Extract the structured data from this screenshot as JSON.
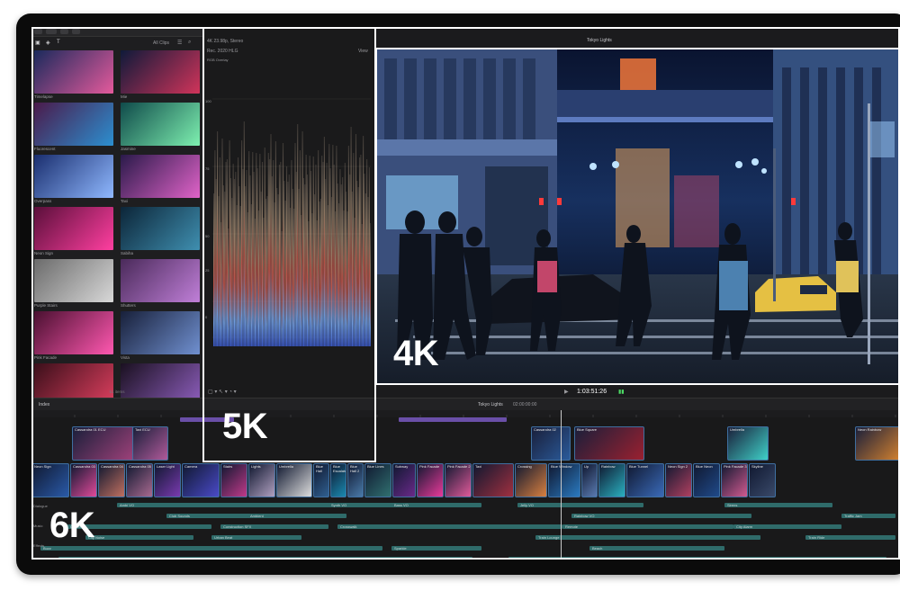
{
  "browser": {
    "filter": "All Clips",
    "count": "51 items",
    "clips": [
      "Timelapse",
      "Mie",
      "Fluorescent",
      "Jasmine",
      "Overpass",
      "Taxi",
      "Neon Sign",
      "Sabiha",
      "Purple Stairs",
      "Shutters",
      "Pink Facade",
      "Vista",
      "",
      ""
    ]
  },
  "scope": {
    "format": "4K 23.98p, Stereo",
    "colorspace": "Rec. 2020 HLG",
    "mode": "RGB Overlay",
    "scale": [
      "100",
      "75",
      "50",
      "25",
      "0"
    ]
  },
  "viewer": {
    "title": "Tokyo Lights",
    "view": "View",
    "zoom": "View ▾"
  },
  "labels": {
    "k4": "4K",
    "k5": "5K",
    "k6": "6K"
  },
  "timeline": {
    "index": "Index",
    "project": "Tokyo Lights",
    "timecode": "1:03:51:26",
    "duration": "02:00:00:00",
    "titles": [
      "Night 1",
      "Night 2"
    ],
    "connected": [
      "Cassandra 01 ECU",
      "Cassandra 02",
      "Blue Square",
      "Umbrella",
      "Neon Rainbow",
      "Taxi ECU"
    ],
    "main": [
      "Neon Sign",
      "Cassandra 03",
      "Cassandra 04",
      "Cassandra 05",
      "Laser Light",
      "Camera",
      "Stairs",
      "Lights",
      "Umbrella",
      "Blue Hall",
      "Blue Escalator",
      "Blue Hall 2",
      "Blue Lines",
      "Subway",
      "Pink Facade",
      "Pink Facade 2",
      "Taxi",
      "Crossing",
      "Blue Window",
      "Up",
      "Rainbow",
      "Blue Tunnel",
      "Neon Sign 2",
      "Blue Neon",
      "Pink Facade 3",
      "Skyline"
    ],
    "audio": [
      "Ambi VO",
      "Club Sounds",
      "Ambient",
      "Synth VO",
      "Bass VO",
      "Jelly VO",
      "Rainbow VO",
      "Sirens",
      "Traffic Jam",
      "Crowd",
      "Construction SFX",
      "Crosswalk",
      "Remote",
      "City Alarm",
      "City Noise",
      "Urban Beat",
      "Train Lounge",
      "Train Ride",
      "Buzz",
      "Sparkle",
      "Beach"
    ],
    "roles": [
      "Dialogue",
      "Music",
      "Effects"
    ]
  }
}
